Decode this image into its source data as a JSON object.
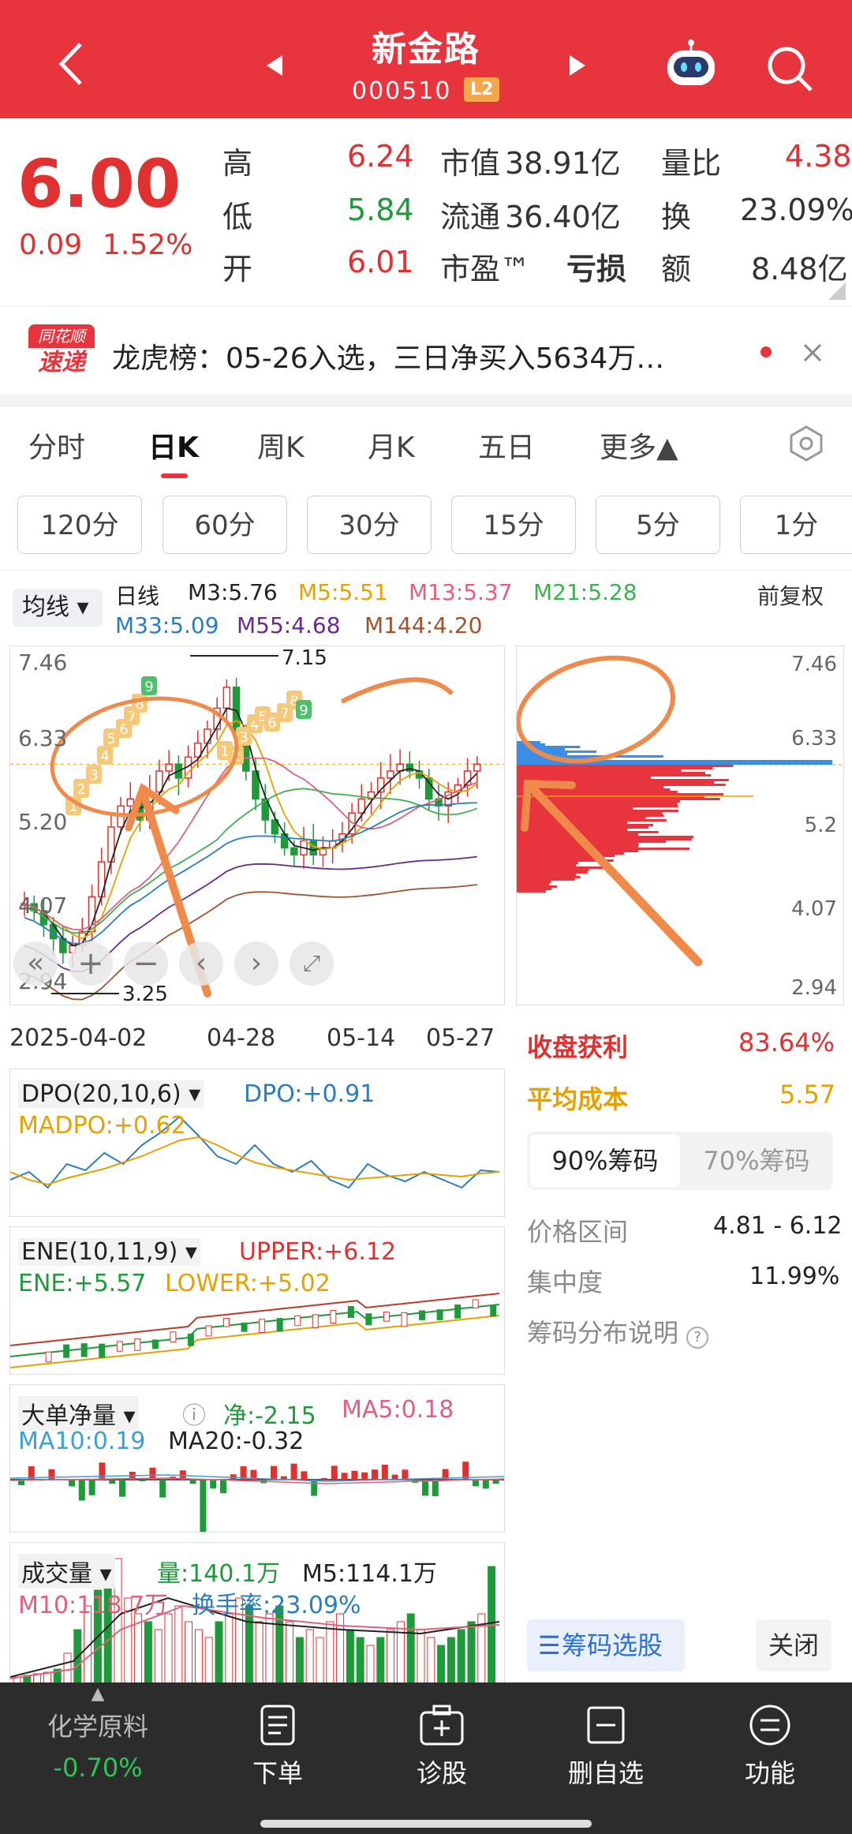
{
  "header": {
    "title": "新金路",
    "code": "000510",
    "badge": "L2"
  },
  "quote": {
    "price": "6.00",
    "change": "0.09",
    "change_pct": "1.52%",
    "high_label": "高",
    "high": "6.24",
    "low_label": "低",
    "low": "5.84",
    "open_label": "开",
    "open": "6.01",
    "mktcap_label": "市值",
    "mktcap": "38.91亿",
    "float_label": "流通",
    "float": "36.40亿",
    "pe_label": "市盈™",
    "pe": "亏损",
    "volratio_label": "量比",
    "volratio": "4.38",
    "turnover_label": "换",
    "turnover": "23.09%",
    "amount_label": "额",
    "amount": "8.48亿"
  },
  "news": {
    "logo_top": "同花顺",
    "logo_bottom": "速递",
    "text": "龙虎榜：05-26入选，三日净买入5634万…"
  },
  "tabs": [
    "分时",
    "日K",
    "周K",
    "月K",
    "五日",
    "更多▲"
  ],
  "periods": [
    "120分",
    "60分",
    "30分",
    "15分",
    "5分",
    "1分"
  ],
  "ma_bar": {
    "selector": "均线",
    "label": "日线",
    "m3": "M3:5.76",
    "m5": "M5:5.51",
    "m13": "M13:5.37",
    "m21": "M21:5.28",
    "m33": "M33:5.09",
    "m55": "M55:4.68",
    "m144": "M144:4.20",
    "adjust": "前复权"
  },
  "kline": {
    "y_ticks": [
      "7.46",
      "6.33",
      "5.20",
      "4.07",
      "2.94"
    ],
    "x_ticks": [
      "2025-04-02",
      "04-28",
      "05-14",
      "05-27"
    ],
    "high_marker": "7.15",
    "low_marker": "3.25",
    "nine_labels_a": [
      "1",
      "2",
      "3",
      "4",
      "5",
      "6",
      "7",
      "8",
      "9"
    ],
    "nine_labels_b": [
      "1",
      "2",
      "3",
      "4",
      "5",
      "6",
      "7",
      "8",
      "9"
    ]
  },
  "chip": {
    "y_ticks": [
      "7.46",
      "6.33",
      "5.2",
      "4.07",
      "2.94"
    ],
    "profit_label": "收盘获利",
    "profit": "83.64%",
    "cost_label": "平均成本",
    "cost": "5.57",
    "tab90": "90%筹码",
    "tab70": "70%筹码",
    "range_label": "价格区间",
    "range": "4.81 - 6.12",
    "conc_label": "集中度",
    "conc": "11.99%",
    "help": "筹码分布说明",
    "select_btn": "筹码选股",
    "close_btn": "关闭"
  },
  "dpo": {
    "name": "DPO(20,10,6)",
    "dpo": "DPO:+0.91",
    "madpo": "MADPO:+0.62"
  },
  "ene": {
    "name": "ENE(10,11,9)",
    "upper": "UPPER:+6.12",
    "ene": "ENE:+5.57",
    "lower": "LOWER:+5.02"
  },
  "bigorder": {
    "name": "大单净量",
    "net": "净:-2.15",
    "ma5": "MA5:0.18",
    "ma10": "MA10:0.19",
    "ma20": "MA20:-0.32"
  },
  "volume": {
    "name": "成交量",
    "vol": "量:140.1万",
    "m5": "M5:114.1万",
    "m10": "M10:118.7万",
    "turn": "换手率:23.09%"
  },
  "bottom": {
    "sector": "化学原料",
    "sector_pct": "-0.70%",
    "items": [
      "下单",
      "诊股",
      "删自选",
      "功能"
    ]
  },
  "colors": {
    "brand": "#e8343c",
    "up": "#e03030",
    "down": "#1f9a3a",
    "accent_orange": "#f08a4b"
  }
}
